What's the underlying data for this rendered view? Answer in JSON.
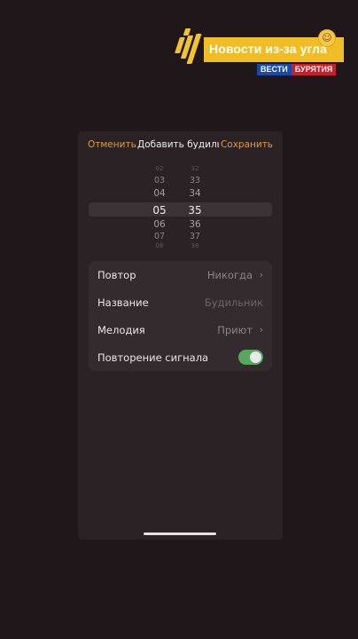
{
  "watermark": {
    "title": "Новости из-за угла",
    "badge_left": "ВЕСТИ",
    "badge_right": "БУРЯТИЯ",
    "emoji_icon": "smiling-face-icon",
    "brand_color": "#f0bd26"
  },
  "nav": {
    "cancel_label": "Отменить",
    "title": "Добавить будильник",
    "save_label": "Сохранить",
    "accent_color": "#e09a3b"
  },
  "picker": {
    "hours": [
      "02",
      "03",
      "04",
      "05",
      "06",
      "07",
      "08"
    ],
    "minutes": [
      "32",
      "33",
      "34",
      "35",
      "36",
      "37",
      "38"
    ],
    "selected_hour": "05",
    "selected_minute": "35"
  },
  "settings": {
    "repeat": {
      "label": "Повтор",
      "value": "Никогда"
    },
    "name": {
      "label": "Название",
      "placeholder": "Будильник"
    },
    "sound": {
      "label": "Мелодия",
      "value": "Приют"
    },
    "snooze": {
      "label": "Повторение сигнала",
      "enabled": true,
      "on_color": "#57a85e"
    }
  }
}
